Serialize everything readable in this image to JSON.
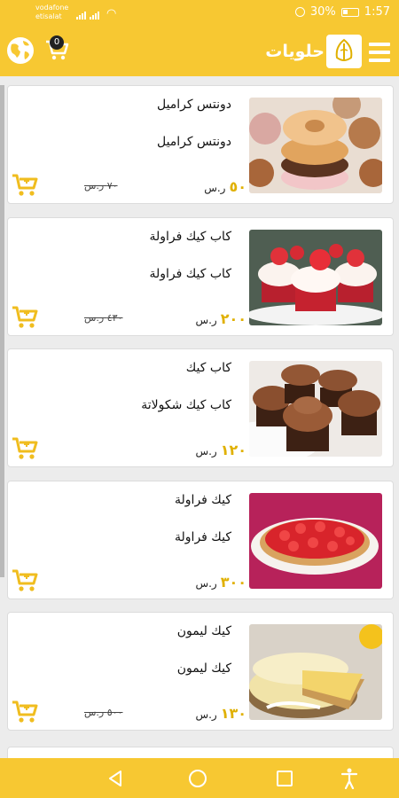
{
  "status": {
    "carrier1": "vodafone",
    "carrier2": "etisalat",
    "battery": "30%",
    "time": "1:57"
  },
  "header": {
    "title": "حلويات",
    "cart_count": "0"
  },
  "products": [
    {
      "name": "دونتس كراميل",
      "desc": "دونتس كراميل",
      "price": "٥٠",
      "currency": "ر.س",
      "old_price": "٧٠ ر.س"
    },
    {
      "name": "كاب كيك فراولة",
      "desc": "كاب كيك فراولة",
      "price": "٢٠٠",
      "currency": "ر.س",
      "old_price": "٤٣٠ ر.س"
    },
    {
      "name": "كاب كيك",
      "desc": "كاب كيك شكولاتة",
      "price": "١٢٠",
      "currency": "ر.س",
      "old_price": ""
    },
    {
      "name": "كيك فراولة",
      "desc": "كيك فراولة",
      "price": "٣٠٠",
      "currency": "ر.س",
      "old_price": ""
    },
    {
      "name": "كيك ليمون",
      "desc": "كيك ليمون",
      "price": "١٣٠",
      "currency": "ر.س",
      "old_price": "٥٠٠ ر.س"
    }
  ],
  "colors": {
    "brand": "#f7c832",
    "accent": "#e0b000"
  },
  "icons": [
    "globe-icon",
    "cart-icon",
    "menu-icon",
    "add-to-cart-icon",
    "back-icon",
    "home-icon",
    "recents-icon",
    "accessibility-icon"
  ]
}
